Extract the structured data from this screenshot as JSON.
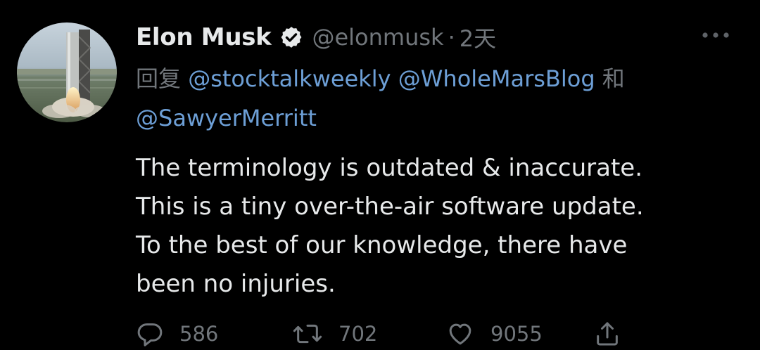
{
  "author": {
    "display_name": "Elon Musk",
    "handle": "@elonmusk",
    "separator": "·",
    "time": "2天",
    "avatar_icon": "rocket-photo-avatar",
    "verified_icon": "verified-badge-icon"
  },
  "reply": {
    "prefix": "回复",
    "mention_1": "@stocktalkweekly",
    "mention_2": "@WholeMarsBlog",
    "conjunction": "和",
    "mention_3": "@SawyerMerritt"
  },
  "tweet": {
    "text": "The terminology is outdated & inaccurate.\nThis is a tiny over-the-air software update.\nTo the best of our knowledge, there have\nbeen no injuries."
  },
  "actions": {
    "reply_count": "586",
    "retweet_count": "702",
    "like_count": "9055"
  },
  "colors": {
    "background": "#000000",
    "text": "#e7e9ea",
    "muted": "#71767b",
    "link": "#6d9fd6"
  }
}
